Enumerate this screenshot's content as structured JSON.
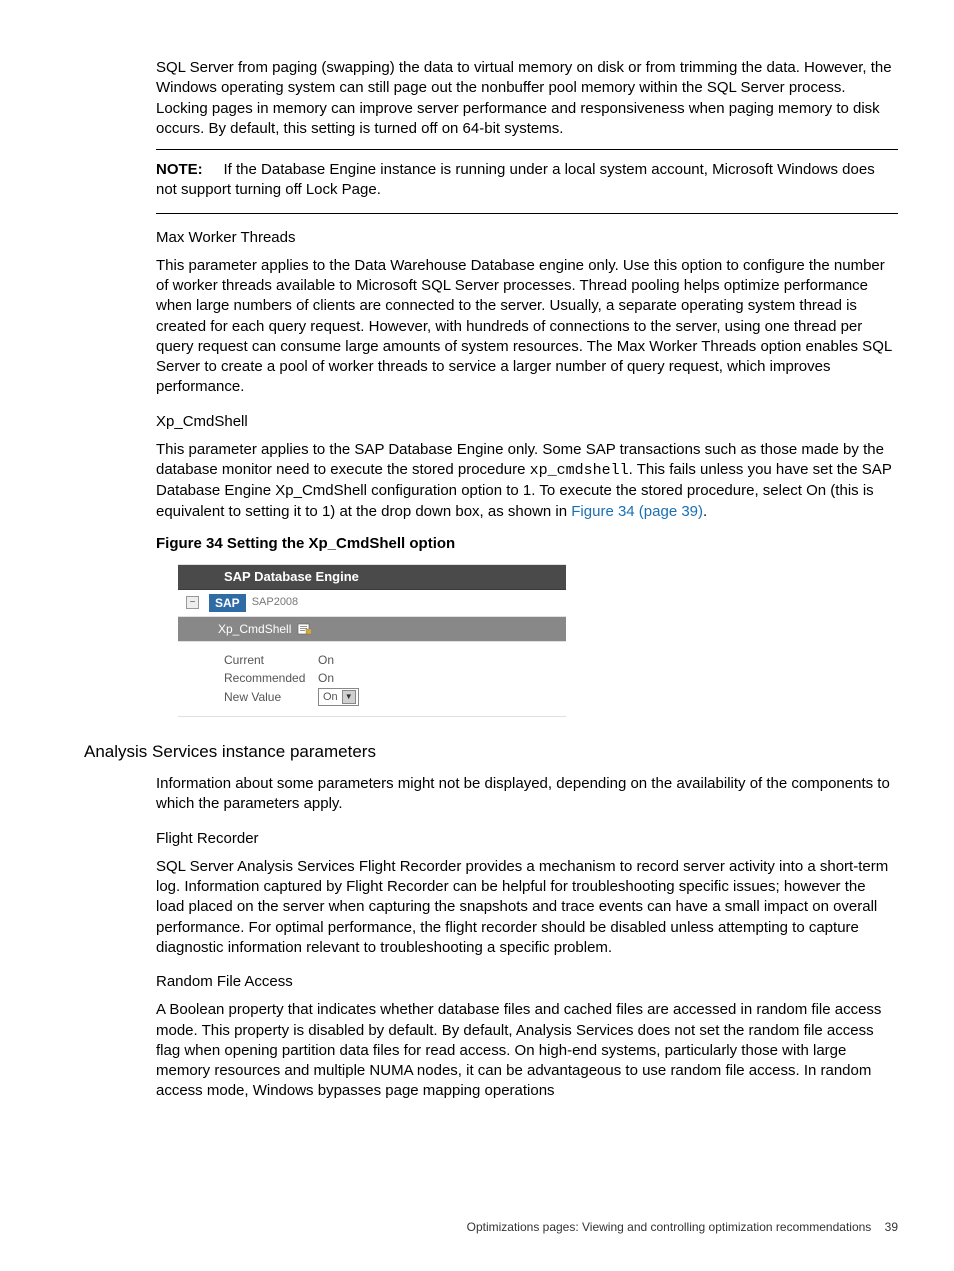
{
  "intro_para": "SQL Server from paging (swapping) the data to virtual memory on disk or from trimming the data. However, the Windows operating system can still page out the nonbuffer pool memory within the SQL Server process. Locking pages in memory can improve server performance and responsiveness when paging memory to disk occurs. By default, this setting is turned off on 64-bit systems.",
  "note": {
    "label": "NOTE:",
    "text": "If the Database Engine instance is running under a local system account, Microsoft Windows does not support turning off Lock Page."
  },
  "max_worker": {
    "heading": "Max Worker Threads",
    "para": "This parameter applies to the Data Warehouse Database engine only.  Use this option to configure the number of worker threads available to Microsoft SQL Server processes. Thread pooling helps optimize performance when large numbers of clients are connected to the server. Usually, a separate operating system thread is created for each query request. However, with hundreds of connections to the server, using one thread per query request can consume large amounts of system resources. The Max Worker Threads option enables SQL Server to create a pool of worker threads to service a larger number of query request, which improves performance."
  },
  "xp_cmdshell": {
    "heading": "Xp_CmdShell",
    "para_pre_mono": "This parameter applies to the SAP Database Engine only. Some SAP transactions such as those made by the database monitor need to execute the stored procedure ",
    "mono": "xp_cmdshell",
    "para_post_mono": ". This fails unless you have set the SAP Database Engine Xp_CmdShell configuration option to 1. To execute the stored procedure, select On (this is equivalent to setting it to 1) at the drop down box, as shown in ",
    "link_text": "Figure 34 (page 39)",
    "para_end": "."
  },
  "figure": {
    "caption": "Figure 34 Setting the Xp_CmdShell option",
    "header": "SAP Database Engine",
    "sap_logo": "SAP",
    "sap_name": "SAP2008",
    "xp_label": "Xp_CmdShell",
    "rows": {
      "current_label": "Current",
      "current_value": "On",
      "recommended_label": "Recommended",
      "recommended_value": "On",
      "newvalue_label": "New Value",
      "select_value": "On"
    }
  },
  "analysis": {
    "heading": "Analysis Services instance parameters",
    "para": "Information about some parameters might not be displayed, depending on the availability of the components to which the parameters apply."
  },
  "flight_recorder": {
    "heading": "Flight Recorder",
    "para": "SQL Server Analysis Services Flight Recorder provides a mechanism to record server activity into a short-term log. Information captured by Flight Recorder can be helpful for troubleshooting specific issues; however the load placed on the server when capturing the snapshots and trace events can have a small impact on overall performance.  For optimal performance, the flight recorder should be disabled unless attempting to capture diagnostic information relevant to troubleshooting a specific problem."
  },
  "random_file": {
    "heading": "Random File Access",
    "para": "A Boolean property that indicates whether database files and cached files are accessed in random file access mode. This property is disabled by default. By default, Analysis Services does not set the random file access flag when opening partition data files for read access. On high-end systems, particularly those with large memory resources and multiple NUMA nodes, it can be advantageous to use random file access. In random access mode, Windows bypasses page mapping operations"
  },
  "footer": {
    "text": "Optimizations pages: Viewing and controlling optimization recommendations",
    "page_num": "39"
  }
}
